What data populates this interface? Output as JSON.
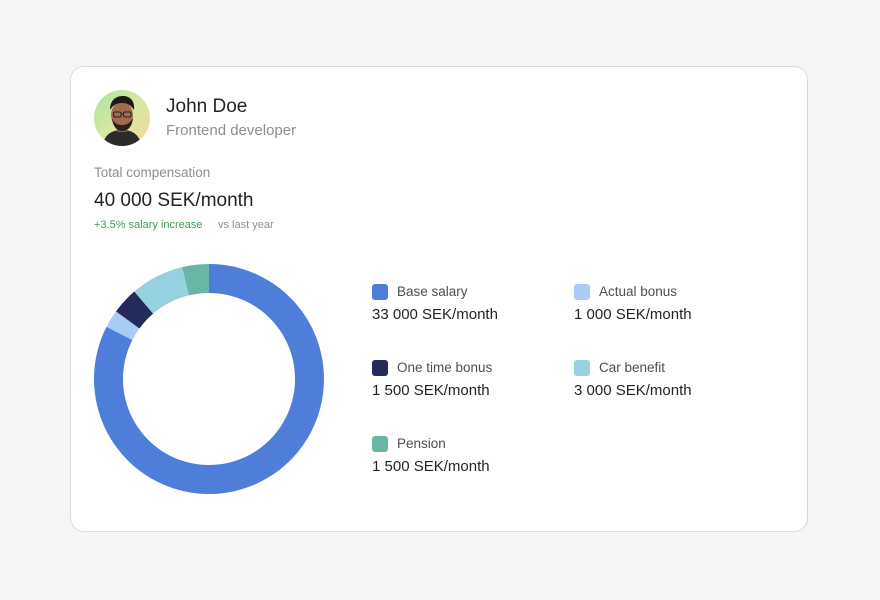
{
  "profile": {
    "name": "John Doe",
    "role": "Frontend developer"
  },
  "compensation": {
    "label": "Total compensation",
    "value": "40 000 SEK/month",
    "increase": "+3.5% salary increase",
    "comparison": "vs last year"
  },
  "colors": {
    "base": "#4e7ed9",
    "actual_bonus": "#a9ccf6",
    "one_time": "#222b5c",
    "car": "#95d1de",
    "pension": "#67b6a6",
    "increase_text": "#3f9b55"
  },
  "chart_data": {
    "type": "pie",
    "series": [
      {
        "name": "Base salary",
        "value": 33000,
        "display": "33 000 SEK/month",
        "color": "#4e7ed9"
      },
      {
        "name": "Actual bonus",
        "value": 1000,
        "display": "1 000 SEK/month",
        "color": "#a9ccf6"
      },
      {
        "name": "One time bonus",
        "value": 1500,
        "display": "1 500 SEK/month",
        "color": "#222b5c"
      },
      {
        "name": "Car benefit",
        "value": 3000,
        "display": "3 000 SEK/month",
        "color": "#95d1de"
      },
      {
        "name": "Pension",
        "value": 1500,
        "display": "1 500 SEK/month",
        "color": "#67b6a6"
      }
    ]
  }
}
